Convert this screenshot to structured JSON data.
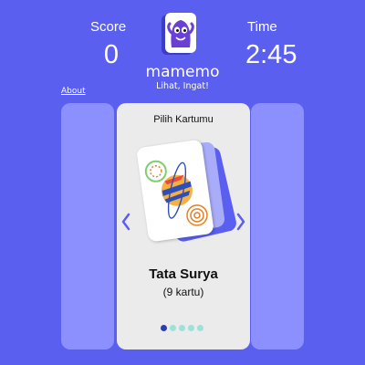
{
  "header": {
    "score_label": "Score",
    "score_value": "0",
    "time_label": "Time",
    "time_value": "2:45",
    "app_name": "mamemo",
    "tagline": "Lihat, Ingat!"
  },
  "nav": {
    "about_label": "About"
  },
  "carousel": {
    "heading": "Pilih Kartumu",
    "deck_name": "Tata Surya",
    "deck_count": "(9 kartu)",
    "page_count": 5,
    "active_page": 1
  },
  "colors": {
    "background": "#5b5fef",
    "side_panel": "#8c90ff",
    "card_bg": "#ebebeb",
    "dot_active": "#2a3fa8",
    "dot_inactive": "#9fe0da"
  },
  "icons": {
    "logo": "mascot-card-icon",
    "prev": "chevron-left-icon",
    "next": "chevron-right-icon",
    "deck_art": "planet-icon"
  }
}
